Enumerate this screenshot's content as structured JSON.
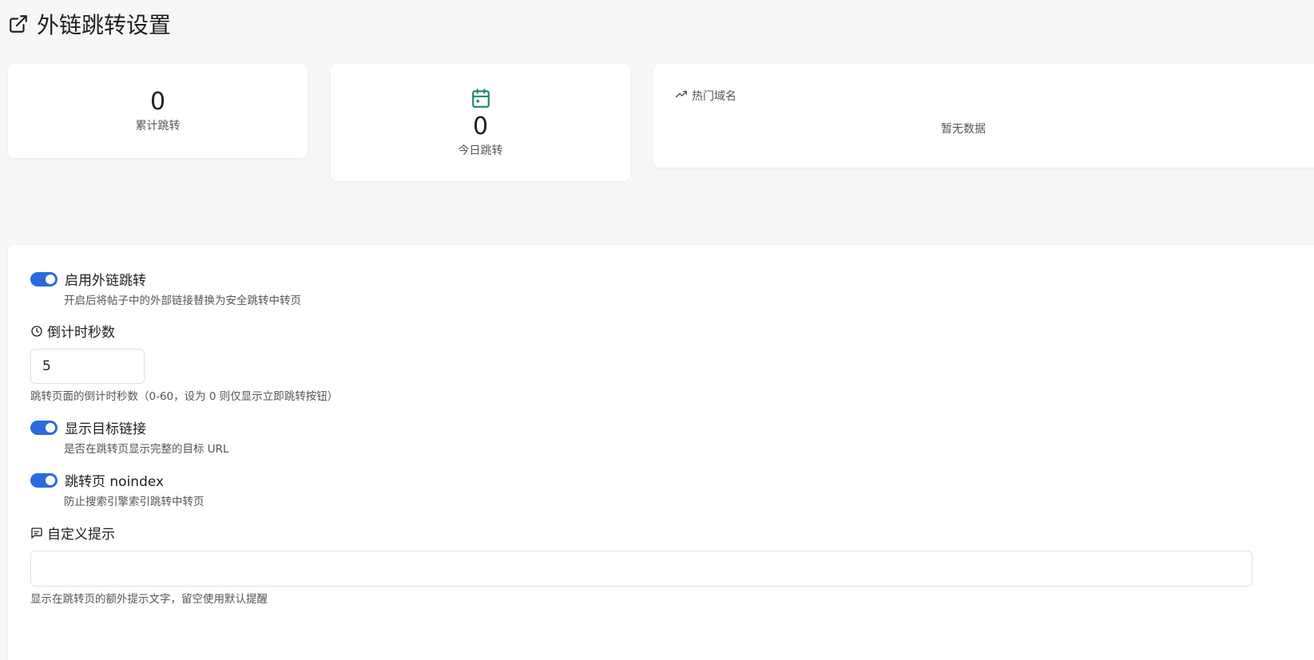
{
  "header": {
    "title": "外链跳转设置",
    "icon": "external-link-icon"
  },
  "stats": {
    "total": {
      "value": "0",
      "label": "累计跳转"
    },
    "today": {
      "value": "0",
      "label": "今日跳转",
      "icon": "calendar-icon",
      "icon_color": "#1e8a5a"
    }
  },
  "hot_domains": {
    "title": "热门域名",
    "icon": "trending-up-icon",
    "empty_text": "暂无数据"
  },
  "settings": {
    "enable_redirect": {
      "label": "启用外链跳转",
      "desc": "开启后将帖子中的外部链接替换为安全跳转中转页",
      "enabled": true
    },
    "countdown": {
      "label": "倒计时秒数",
      "icon": "clock-icon",
      "value": "5",
      "desc": "跳转页面的倒计时秒数（0-60，设为 0 则仅显示立即跳转按钮）"
    },
    "show_target": {
      "label": "显示目标链接",
      "desc": "是否在跳转页显示完整的目标 URL",
      "enabled": true
    },
    "noindex": {
      "label": "跳转页 noindex",
      "desc": "防止搜索引擎索引跳转中转页",
      "enabled": true
    },
    "custom_hint": {
      "label": "自定义提示",
      "icon": "message-square-icon",
      "value": "",
      "desc": "显示在跳转页的额外提示文字，留空使用默认提醒"
    }
  },
  "colors": {
    "accent": "#2a6be0",
    "background": "#f6f7f9",
    "card": "#ffffff"
  }
}
